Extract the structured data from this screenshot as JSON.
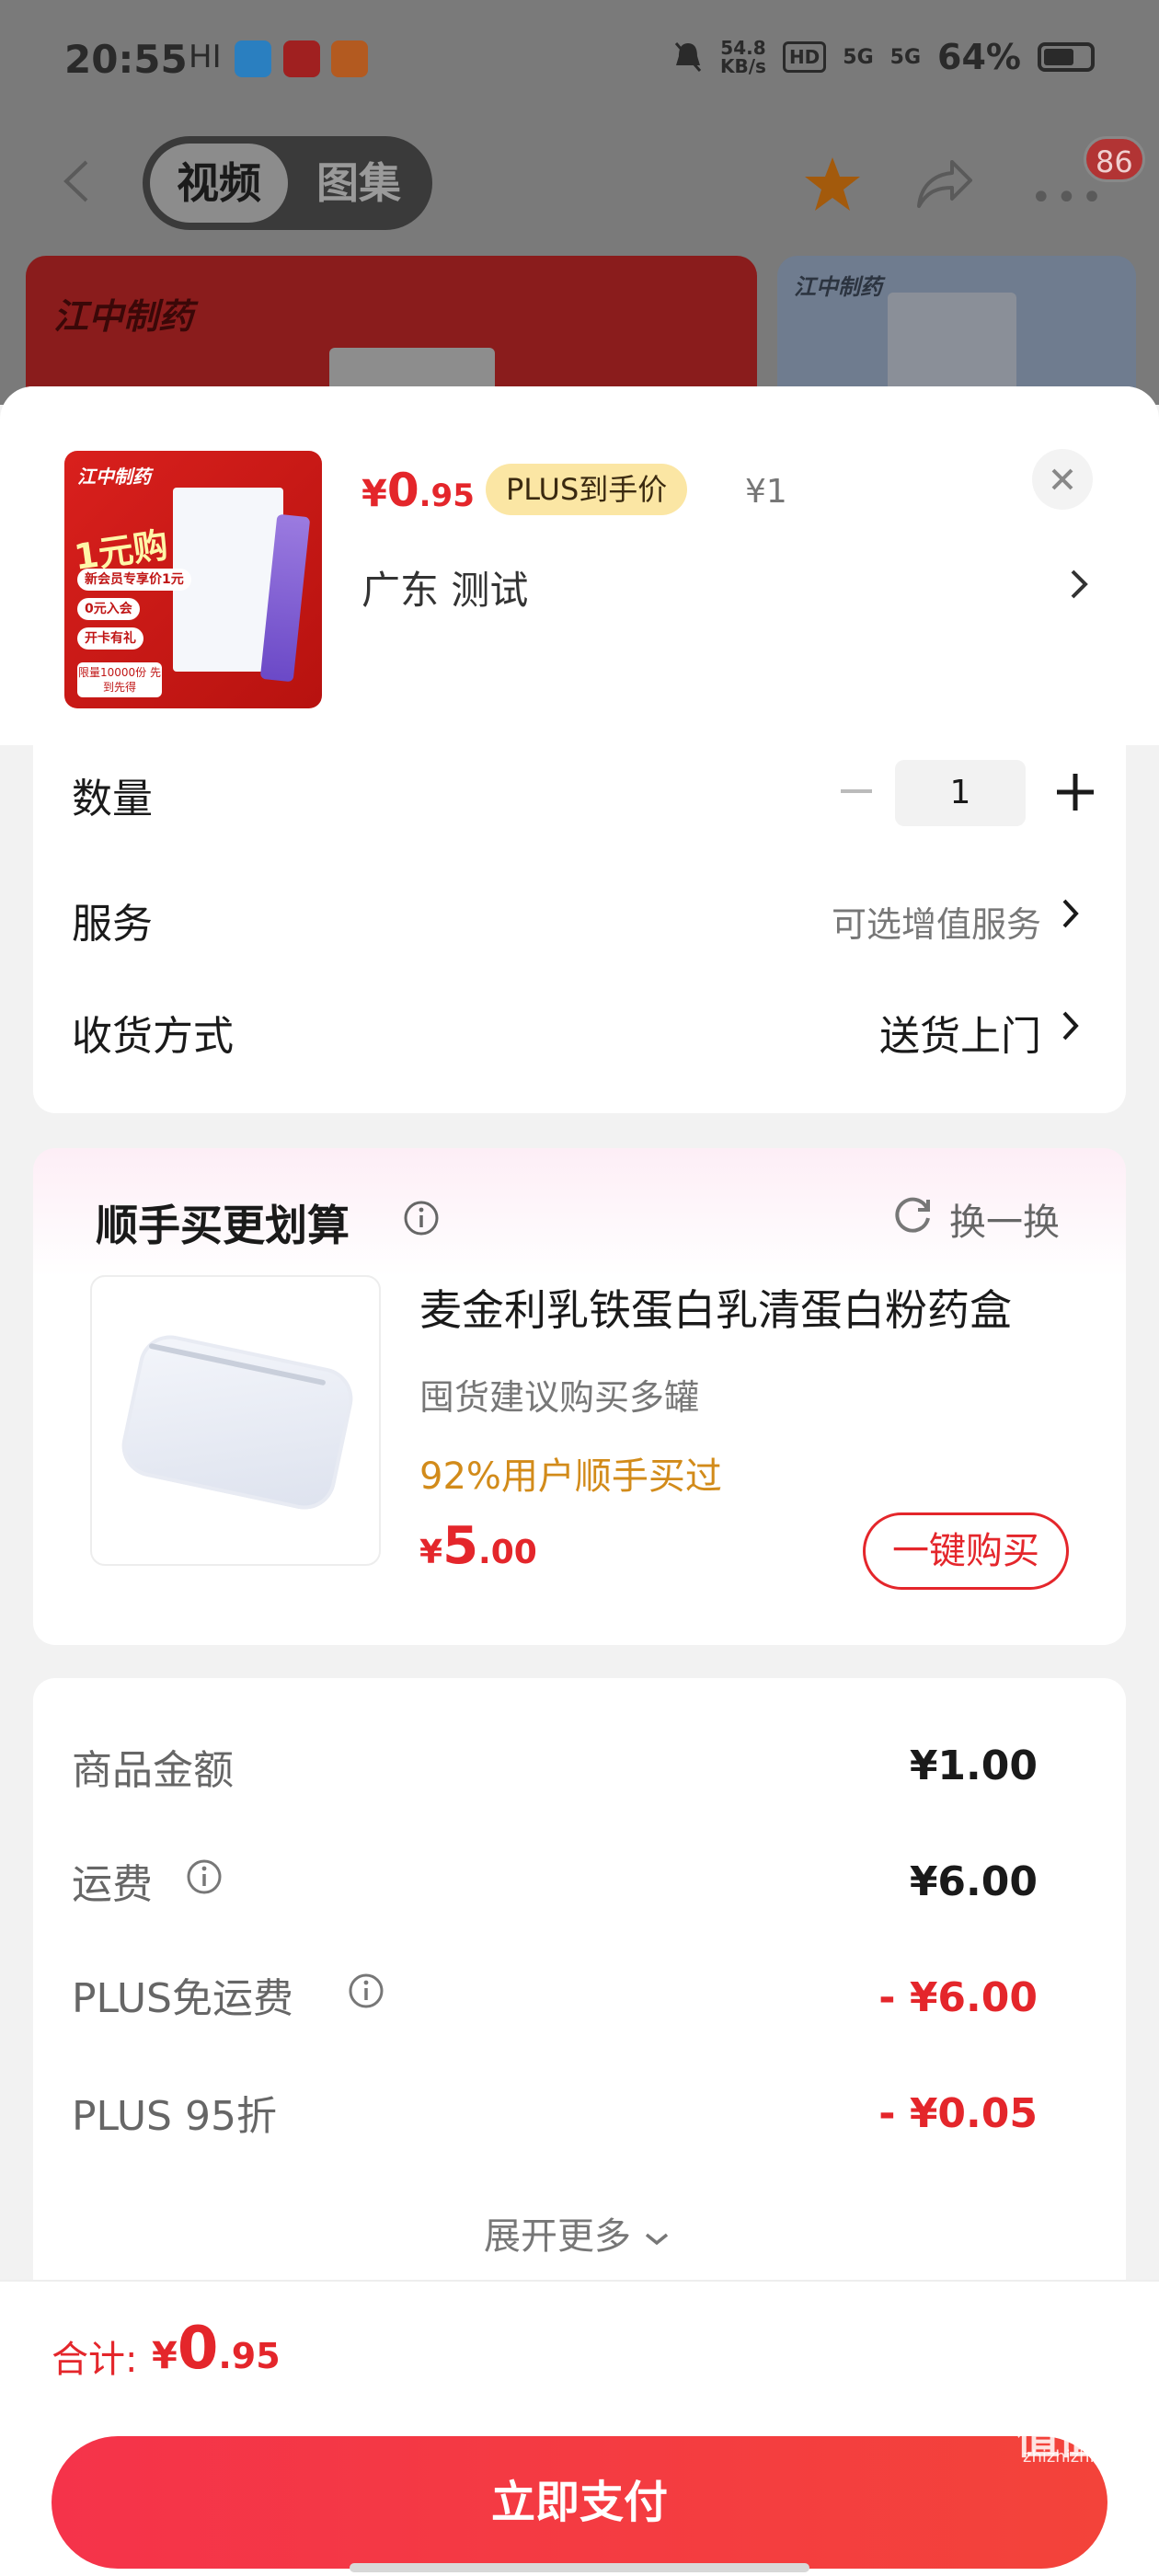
{
  "status_bar": {
    "time": "20:55",
    "hd_label": "HD",
    "network_speed": "54.8",
    "network_unit": "KB/s",
    "signal_1": "5G",
    "signal_2": "5G",
    "battery": "64%"
  },
  "nav": {
    "tabs": [
      "视频",
      "图集"
    ],
    "active_tab": "视频",
    "message_count": "86"
  },
  "banner": {
    "brand": "江中制药"
  },
  "product": {
    "thumb_brand": "江中制药",
    "thumb_headline": "1元购",
    "thumb_pills": [
      "新会员专享价1元",
      "0元入会",
      "开卡有礼"
    ],
    "thumb_footer": "限量10000份 先到先得",
    "price_currency": "¥",
    "price_int": "0",
    "price_dec": ".95",
    "plus_tag": "PLUS到手价",
    "original_price": "¥1",
    "address": "广东  测试"
  },
  "options": {
    "quantity_label": "数量",
    "quantity_value": "1",
    "service_label": "服务",
    "service_value": "可选增值服务",
    "delivery_label": "收货方式",
    "delivery_value": "送货上门"
  },
  "recommend": {
    "title": "顺手买更划算",
    "refresh_label": "换一换",
    "item_name": "麦金利乳铁蛋白乳清蛋白粉药盒",
    "item_sub": "囤货建议购买多罐",
    "item_pct": "92%用户顺手买过",
    "price_currency": "¥",
    "price_int": "5",
    "price_dec": ".00",
    "buy_label": "一键购买"
  },
  "summary": {
    "rows": [
      {
        "label": "商品金额",
        "value": "¥1.00",
        "info": false,
        "red": false
      },
      {
        "label": "运费",
        "value": "¥6.00",
        "info": true,
        "red": false
      },
      {
        "label": "PLUS免运费",
        "value": "- ¥6.00",
        "info": true,
        "red": true
      },
      {
        "label": "PLUS 95折",
        "value": "- ¥0.05",
        "info": false,
        "red": true
      }
    ],
    "expand_label": "展开更多"
  },
  "total": {
    "label": "合计:",
    "currency": "¥",
    "int": "0",
    "dec": ".95"
  },
  "pay_button": "立即支付",
  "watermark": {
    "text": "值值值",
    "url": "zhizhizhi.com"
  },
  "colors": {
    "accent_red": "#e4262b",
    "plus_gold": "#fbe6a4",
    "pct_orange": "#d28b1a"
  }
}
